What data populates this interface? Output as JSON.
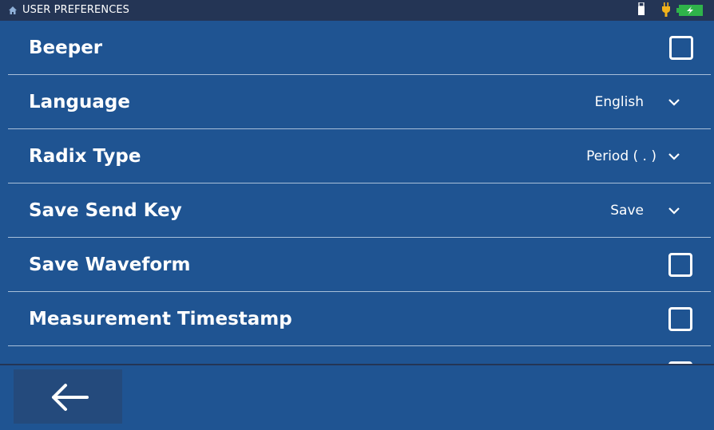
{
  "status_bar": {
    "title": "USER PREFERENCES",
    "icons": [
      "home-icon",
      "usb-icon",
      "power-plug-icon",
      "battery-charging-icon"
    ],
    "battery_color": "#2fb34a",
    "plug_color": "#f2b21b"
  },
  "preferences": {
    "beeper": {
      "label": "Beeper",
      "checked": false
    },
    "language": {
      "label": "Language",
      "value": "English"
    },
    "radix_type": {
      "label": "Radix Type",
      "value": "Period ( . )"
    },
    "save_send_key": {
      "label": "Save Send Key",
      "value": "Save"
    },
    "save_waveform": {
      "label": "Save Waveform",
      "checked": false
    },
    "measurement_timestamp": {
      "label": "Measurement Timestamp",
      "checked": false
    }
  },
  "footer": {
    "back_icon": "arrow-left-icon"
  },
  "colors": {
    "background": "#1f5492",
    "status_bar": "#243555",
    "back_button": "#244a7c",
    "row_divider": "#a8bfd9"
  }
}
